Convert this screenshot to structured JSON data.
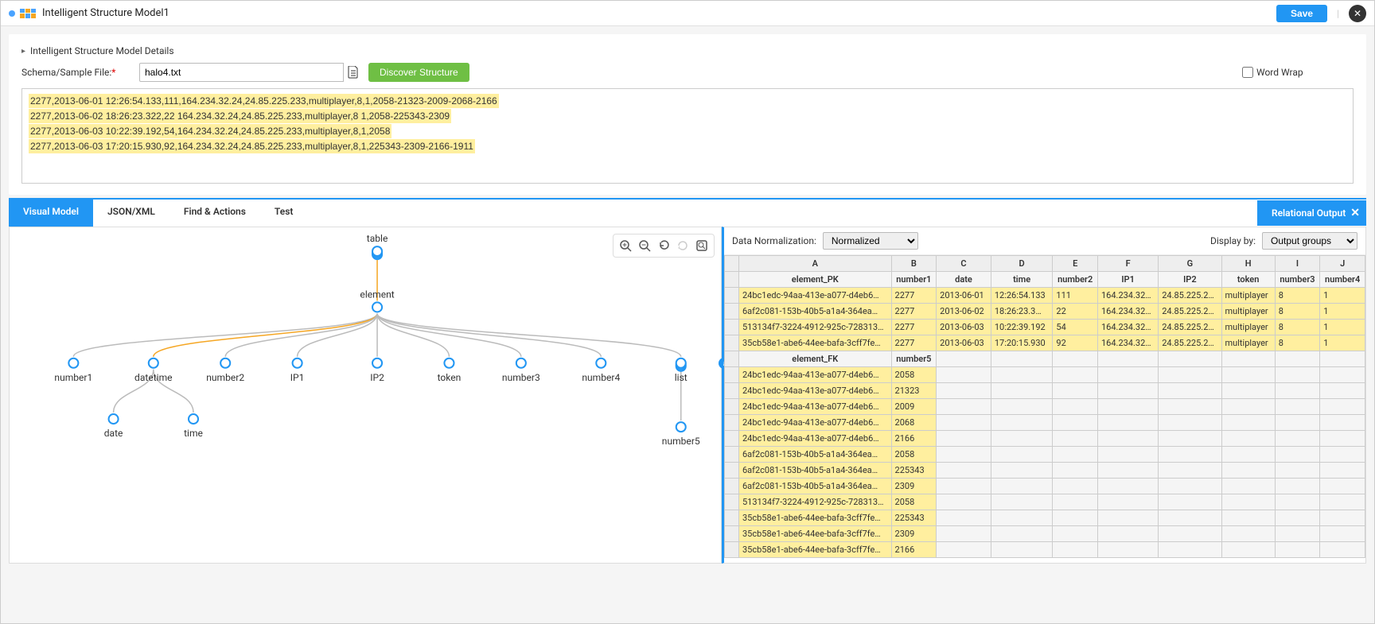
{
  "header": {
    "title": "Intelligent Structure Model1",
    "save_label": "Save"
  },
  "details": {
    "header": "Intelligent Structure Model Details",
    "schema_label": "Schema/Sample File:",
    "filename": "halo4.txt",
    "discover_label": "Discover Structure",
    "wordwrap_label": "Word Wrap"
  },
  "sample_lines": [
    "2277,2013-06-01 12:26:54.133,111,164.234.32.24,24.85.225.233,multiplayer,8,1,2058-21323-2009-2068-2166",
    "2277,2013-06-02 18:26:23.322,22 164.234.32.24,24.85.225.233,multiplayer,8 1,2058-225343-2309",
    "2277,2013-06-03 10:22:39.192,54,164.234.32.24,24.85.225.233,multiplayer,8,1,2058",
    "2277,2013-06-03 17:20:15.930,92,164.234.32.24,24.85.225.233,multiplayer,8,1,225343-2309-2166-1911"
  ],
  "tabs": {
    "visual": "Visual Model",
    "json": "JSON/XML",
    "find": "Find & Actions",
    "test": "Test",
    "relational": "Relational Output"
  },
  "tree": {
    "table": "table",
    "element": "element",
    "element_tooltip": "element",
    "children": [
      "number1",
      "datetime",
      "number2",
      "IP1",
      "IP2",
      "token",
      "number3",
      "number4",
      "list"
    ],
    "datetime_children": [
      "date",
      "time"
    ],
    "list_child": "number5"
  },
  "right": {
    "norm_label": "Data Normalization:",
    "norm_value": "Normalized",
    "display_label": "Display by:",
    "display_value": "Output groups"
  },
  "grid": {
    "letters": [
      "A",
      "B",
      "C",
      "D",
      "E",
      "F",
      "G",
      "H",
      "I",
      "J"
    ],
    "hdr1": [
      "element_PK",
      "number1",
      "date",
      "time",
      "number2",
      "IP1",
      "IP2",
      "token",
      "number3",
      "number4"
    ],
    "rows1": [
      [
        "24bc1edc-94aa-413e-a077-d4eb6…",
        "2277",
        "2013-06-01",
        "12:26:54.133",
        "111",
        "164.234.32…",
        "24.85.225.2…",
        "multiplayer",
        "8",
        "1"
      ],
      [
        "6af2c081-153b-40b5-a1a4-364ea…",
        "2277",
        "2013-06-02",
        "18:26:23.3…",
        "22",
        "164.234.32…",
        "24.85.225.2…",
        "multiplayer",
        "8",
        "1"
      ],
      [
        "513134f7-3224-4912-925c-728313…",
        "2277",
        "2013-06-03",
        "10:22:39.192",
        "54",
        "164.234.32…",
        "24.85.225.2…",
        "multiplayer",
        "8",
        "1"
      ],
      [
        "35cb58e1-abe6-44ee-bafa-3cff7fe…",
        "2277",
        "2013-06-03",
        "17:20:15.930",
        "92",
        "164.234.32…",
        "24.85.225.2…",
        "multiplayer",
        "8",
        "1"
      ]
    ],
    "hdr2": [
      "element_FK",
      "number5"
    ],
    "rows2": [
      [
        "24bc1edc-94aa-413e-a077-d4eb6…",
        "2058"
      ],
      [
        "24bc1edc-94aa-413e-a077-d4eb6…",
        "21323"
      ],
      [
        "24bc1edc-94aa-413e-a077-d4eb6…",
        "2009"
      ],
      [
        "24bc1edc-94aa-413e-a077-d4eb6…",
        "2068"
      ],
      [
        "24bc1edc-94aa-413e-a077-d4eb6…",
        "2166"
      ],
      [
        "6af2c081-153b-40b5-a1a4-364ea…",
        "2058"
      ],
      [
        "6af2c081-153b-40b5-a1a4-364ea…",
        "225343"
      ],
      [
        "6af2c081-153b-40b5-a1a4-364ea…",
        "2309"
      ],
      [
        "513134f7-3224-4912-925c-728313…",
        "2058"
      ],
      [
        "35cb58e1-abe6-44ee-bafa-3cff7fe…",
        "225343"
      ],
      [
        "35cb58e1-abe6-44ee-bafa-3cff7fe…",
        "2309"
      ],
      [
        "35cb58e1-abe6-44ee-bafa-3cff7fe…",
        "2166"
      ]
    ]
  }
}
